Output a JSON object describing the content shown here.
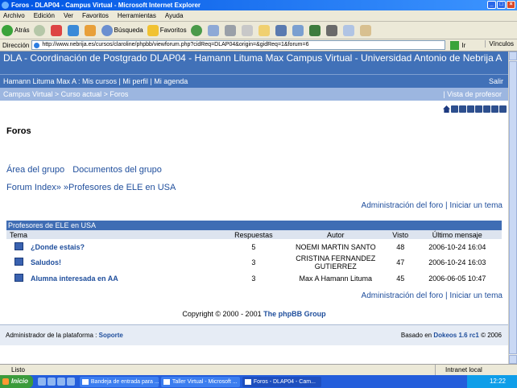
{
  "window": {
    "title": "Foros - DLAP04 - Campus Virtual - Microsoft Internet Explorer"
  },
  "menu": [
    "Archivo",
    "Edición",
    "Ver",
    "Favoritos",
    "Herramientas",
    "Ayuda"
  ],
  "toolbar": {
    "back": "Atrás",
    "search": "Búsqueda",
    "favorites": "Favoritos"
  },
  "address": {
    "label": "Dirección",
    "url": "http://www.nebrija.es/cursos/claroline/phpbb/viewforum.php?cidReq=DLAP04&origin=&gidReq=1&forum=6",
    "go": "Ir",
    "links": "Vínculos"
  },
  "site": {
    "banner": "DLA - Coordinación de Postgrado DLAP04 - Hamann Lituma Max  Campus Virtual - Universidad Antonio de Nebrija A",
    "user_links": "Hamann Lituma Max A : Mis cursos | Mi perfil | Mi agenda",
    "logout": "Salir",
    "breadcrumb": "Campus Virtual > Curso actual > Foros",
    "teacher_view": "|  Vista de profesor"
  },
  "page": {
    "title": "Foros",
    "group_area": "Área del grupo",
    "group_docs": "Documentos del grupo",
    "forum_path": "Forum Index» »Profesores de ELE en USA",
    "admin_links": "Administración del foro | Iniciar un tema"
  },
  "forum": {
    "name": "Profesores de ELE en USA",
    "columns": [
      "Tema",
      "Respuestas",
      "Autor",
      "Visto",
      "Último mensaje"
    ],
    "rows": [
      {
        "topic": "¿Donde estais?",
        "replies": "5",
        "author": "NOEMI MARTIN SANTO",
        "views": "48",
        "last": "2006-10-24 16:04"
      },
      {
        "topic": "Saludos!",
        "replies": "3",
        "author": "CRISTINA FERNANDEZ GUTIERREZ",
        "views": "47",
        "last": "2006-10-24 16:03"
      },
      {
        "topic": "Alumna interesada en AA",
        "replies": "3",
        "author": "Max A Hamann Lituma",
        "views": "45",
        "last": "2006-06-05 10:47"
      }
    ]
  },
  "footer": {
    "copyright": "Copyright © 2000 - 2001",
    "phpbb": "The phpBB Group",
    "admin_label": "Administrador de la plataforma :",
    "admin_link": "Soporte",
    "powered_label": "Basado en",
    "powered_link": "Dokeos 1.6 rc1",
    "powered_year": "© 2006"
  },
  "status": {
    "left": "Listo",
    "zone": "Intranet local"
  },
  "taskbar": {
    "start": "Inicio",
    "tasks": [
      "Bandeja de entrada para ...",
      "Taller Virtual - Microsoft ...",
      "Foros - DLAP04 - Cam..."
    ],
    "clock": "12:22"
  },
  "colors": {
    "banner": "#4171b8",
    "crumb": "#9cb6e0",
    "link": "#1f4e9c"
  }
}
